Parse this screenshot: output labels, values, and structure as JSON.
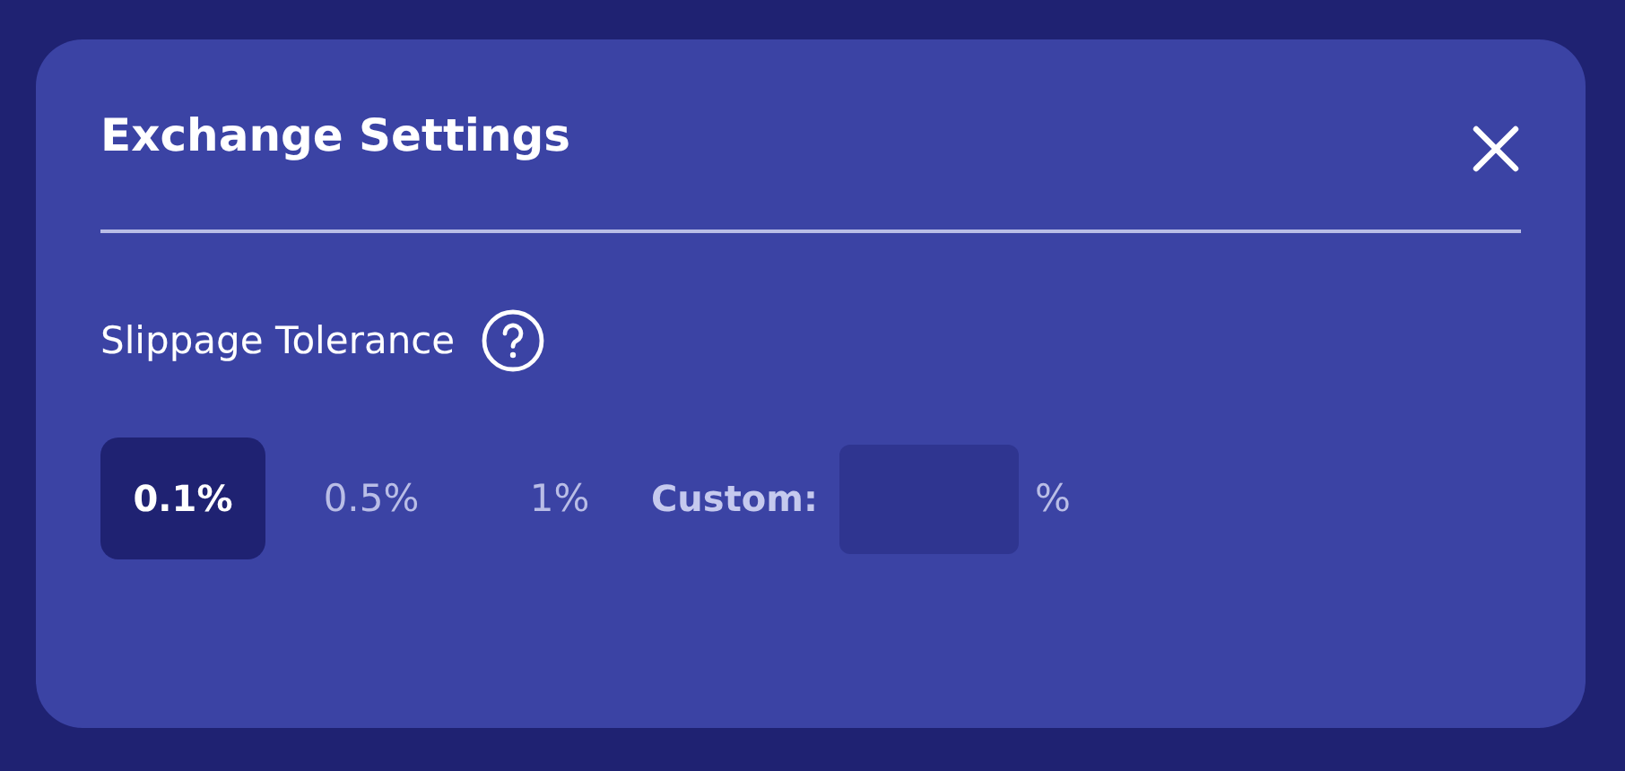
{
  "dialog": {
    "title": "Exchange Settings"
  },
  "slippage": {
    "label": "Slippage Tolerance",
    "options": [
      {
        "label": "0.1%",
        "selected": true
      },
      {
        "label": "0.5%",
        "selected": false
      },
      {
        "label": "1%",
        "selected": false
      }
    ],
    "custom": {
      "label": "Custom:",
      "unit": "%"
    }
  }
}
